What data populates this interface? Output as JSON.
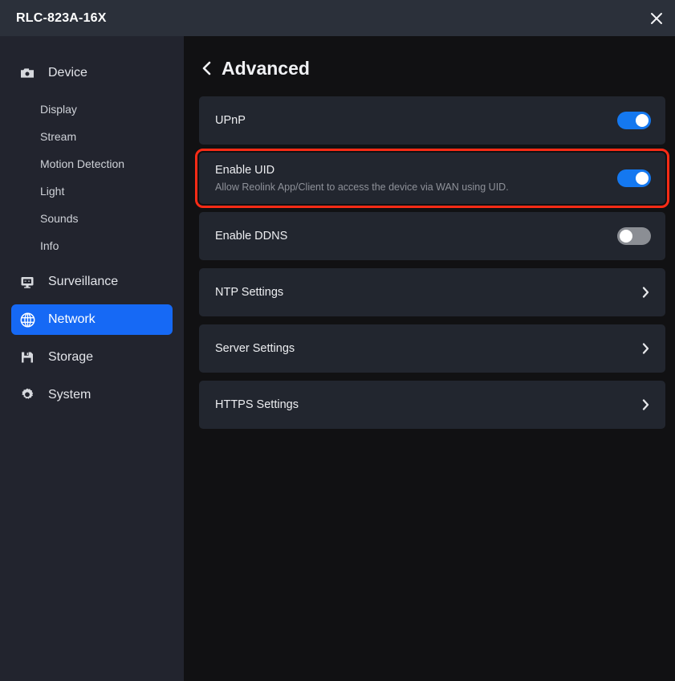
{
  "window": {
    "title": "RLC-823A-16X",
    "close_icon": "close-icon"
  },
  "sidebar": {
    "groups": [
      {
        "label": "Device",
        "icon": "camera-icon",
        "selected": false,
        "children": [
          {
            "label": "Display"
          },
          {
            "label": "Stream"
          },
          {
            "label": "Motion Detection"
          },
          {
            "label": "Light"
          },
          {
            "label": "Sounds"
          },
          {
            "label": "Info"
          }
        ]
      },
      {
        "label": "Surveillance",
        "icon": "monitor-icon",
        "selected": false,
        "children": []
      },
      {
        "label": "Network",
        "icon": "globe-icon",
        "selected": true,
        "children": []
      },
      {
        "label": "Storage",
        "icon": "save-disk-icon",
        "selected": false,
        "children": []
      },
      {
        "label": "System",
        "icon": "gear-icon",
        "selected": false,
        "children": []
      }
    ]
  },
  "main": {
    "back_icon": "back-chevron-icon",
    "title": "Advanced",
    "rows": [
      {
        "label": "UPnP",
        "sub": "",
        "control": "toggle",
        "state": "on",
        "highlighted": false
      },
      {
        "label": "Enable UID",
        "sub": "Allow Reolink App/Client to access the device via WAN using UID.",
        "control": "toggle",
        "state": "on",
        "highlighted": true
      },
      {
        "label": "Enable DDNS",
        "sub": "",
        "control": "toggle",
        "state": "off",
        "highlighted": false
      },
      {
        "label": "NTP Settings",
        "sub": "",
        "control": "chevron",
        "state": "",
        "highlighted": false
      },
      {
        "label": "Server Settings",
        "sub": "",
        "control": "chevron",
        "state": "",
        "highlighted": false
      },
      {
        "label": "HTTPS Settings",
        "sub": "",
        "control": "chevron",
        "state": "",
        "highlighted": false
      }
    ]
  },
  "colors": {
    "titlebar_bg": "#2b303a",
    "sidebar_bg": "#22242e",
    "content_bg": "#111113",
    "card_bg": "#22262f",
    "accent_blue": "#1669f5",
    "toggle_on": "#1478f0",
    "toggle_off": "#8b8e94",
    "highlight_red": "#fb2b16"
  }
}
